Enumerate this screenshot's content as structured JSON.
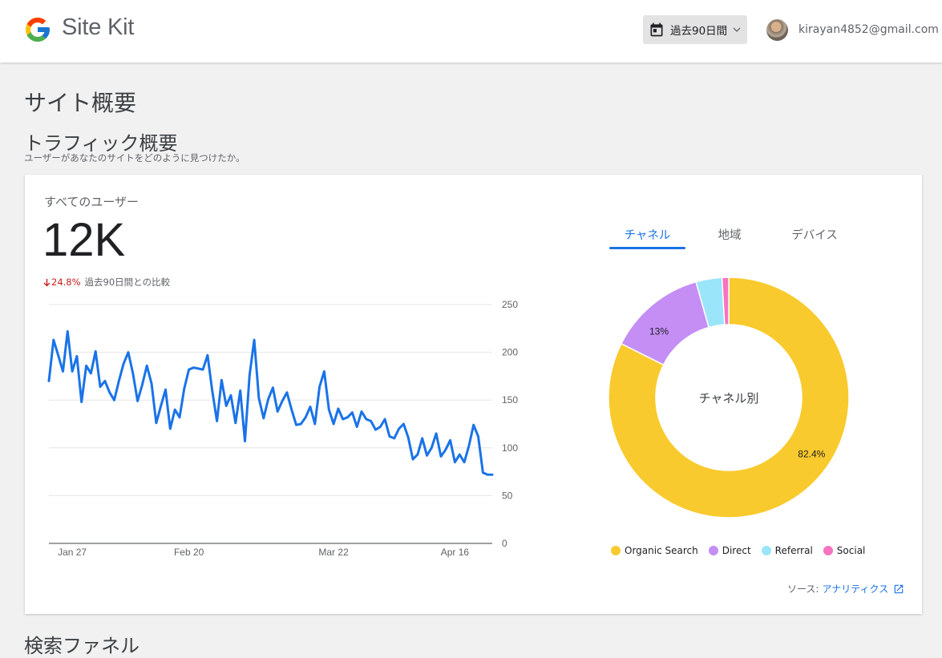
{
  "header": {
    "brand": "Site Kit",
    "date_range": "過去90日間",
    "email": "kirayan4852@gmail.com"
  },
  "page": {
    "title": "サイト概要",
    "section_title": "トラフィック概要",
    "section_subtitle": "ユーザーがあなたのサイトをどのように見つけたか。",
    "next_section_title": "検索ファネル"
  },
  "overview": {
    "users_label": "すべてのユーザー",
    "users_count": "12K",
    "change_pct": "24.8%",
    "change_label": "過去90日間との比較"
  },
  "tabs": [
    "チャネル",
    "地域",
    "デバイス"
  ],
  "source": {
    "label": "ソース:",
    "link": "アナリティクス"
  },
  "colors": {
    "accent": "#1a73e8",
    "line": "#1a73e8",
    "organic": "#f9ca2d",
    "direct": "#c48ef5",
    "referral": "#9be5fb",
    "social": "#f774c2",
    "negative": "#c5221f"
  },
  "chart_data": [
    {
      "type": "line",
      "series": [
        {
          "name": "",
          "values": [
            170,
            213,
            197,
            180,
            222,
            180,
            196,
            148,
            186,
            178,
            201,
            164,
            170,
            158,
            150,
            170,
            188,
            200,
            178,
            149,
            166,
            186,
            167,
            126,
            144,
            161,
            120,
            140,
            132,
            162,
            182,
            184,
            183,
            182,
            197,
            160,
            128,
            171,
            144,
            155,
            126,
            160,
            107,
            176,
            213,
            152,
            131,
            151,
            163,
            138,
            149,
            158,
            140,
            124,
            125,
            132,
            143,
            125,
            164,
            180,
            140,
            125,
            141,
            130,
            132,
            137,
            122,
            138,
            130,
            128,
            119,
            122,
            130,
            112,
            110,
            120,
            125,
            111,
            88,
            93,
            110,
            92,
            100,
            115,
            91,
            98,
            108,
            85,
            93,
            85,
            102,
            124,
            112,
            74,
            72,
            72
          ]
        }
      ],
      "x_tick_labels": [
        "Jan 27",
        "Feb 20",
        "Mar 22",
        "Apr 16"
      ],
      "y_ticks": [
        0,
        50,
        100,
        150,
        200,
        250
      ],
      "ylim": [
        0,
        250
      ],
      "grid": true
    },
    {
      "type": "pie",
      "title": "チャネル別",
      "categories": [
        "Organic Search",
        "Direct",
        "Referral",
        "Social"
      ],
      "values": [
        82.4,
        13.2,
        3.5,
        0.9
      ],
      "labels_shown": [
        "82.4%",
        "13%"
      ],
      "colors": [
        "#f9ca2d",
        "#c48ef5",
        "#9be5fb",
        "#f774c2"
      ]
    }
  ]
}
